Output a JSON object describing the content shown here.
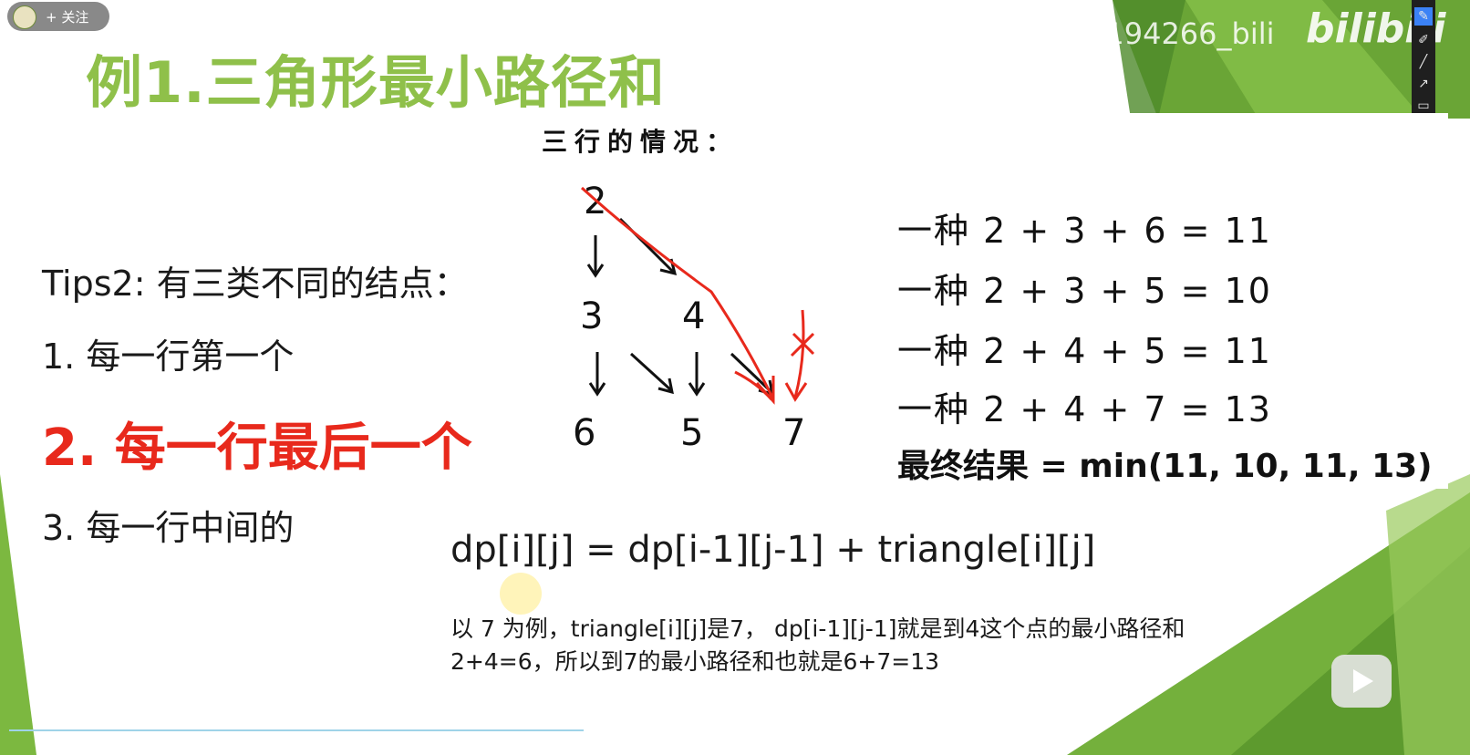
{
  "video": {
    "title": "例1.三角形最小路径和",
    "follow_label": "+ 关注",
    "watermark": "@4194266_bili",
    "logo": "bilibili"
  },
  "handwritten": {
    "header": "三行的情况：",
    "tree": {
      "row1": "2",
      "row2": [
        "3",
        "4"
      ],
      "row3": [
        "6",
        "5",
        "7"
      ]
    },
    "cases": [
      "一种 2 + 3 + 6 = 11",
      "一种 2 + 3 + 5 = 10",
      "一种 2 + 4 + 5 = 11",
      "一种 2 + 4 + 7 = 13"
    ],
    "result": "最终结果 = min(11, 10, 11, 13)"
  },
  "tips": {
    "heading": "Tips2: 有三类不同的结点：",
    "items": [
      "1. 每一行第一个",
      "2. 每一行最后一个",
      "3. 每一行中间的"
    ]
  },
  "formula": "dp[i][j] = dp[i-1][j-1] + triangle[i][j]",
  "explanation": [
    "以 7 为例，triangle[i][j]是7， dp[i-1][j-1]就是到4这个点的最小路径和",
    "2+4=6，所以到7的最小路径和也就是6+7=13"
  ],
  "toolbar_icons": [
    "pen-icon",
    "brush-icon",
    "line-icon",
    "arrow-icon",
    "rectangle-icon",
    "shapes-icon",
    "text-icon",
    "eraser-icon",
    "color-swatch-icon",
    "stroke-icon",
    "collapse-icon"
  ],
  "colors": {
    "accent_green": "#8fc04a",
    "highlight_red": "#e8291c",
    "pen_red": "#e8291c"
  }
}
